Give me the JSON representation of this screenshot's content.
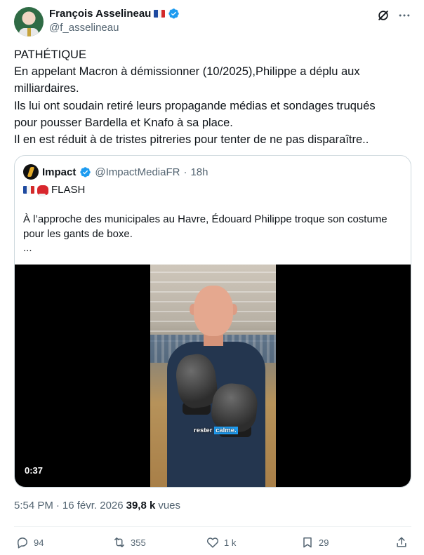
{
  "author": {
    "name": "François Asselineau",
    "handle": "@f_asselineau",
    "flag": "french-flag"
  },
  "post": {
    "lines": [
      "PATHÉTIQUE",
      "En appelant Macron à démissionner (10/2025),Philippe a déplu aux",
      "milliardaires.",
      "Ils lui ont soudain retiré leurs propagande médias et sondages truqués",
      "pour pousser Bardella et Knafo à sa place.",
      "Il en est réduit à de tristes pitreries pour tenter de ne pas disparaître.."
    ]
  },
  "quote": {
    "name": "Impact",
    "handle": "@ImpactMediaFR",
    "separator": "·",
    "time": "18h",
    "flash_label": "FLASH",
    "text_line1": "À l’approche des municipales au Havre, Édouard Philippe troque son costume",
    "text_line2": "pour les gants de boxe.",
    "ellipsis": "...",
    "video": {
      "subtitle_word1": "rester",
      "subtitle_word2": "calme.",
      "duration": "0:37"
    }
  },
  "meta": {
    "time": "5:54 PM",
    "separator": "·",
    "date": "16 févr. 2026",
    "views_count": "39,8 k",
    "views_label": "vues"
  },
  "actions": {
    "replies": "94",
    "reposts": "355",
    "likes": "1 k",
    "bookmarks": "29"
  },
  "colors": {
    "accent": "#1d9bf0",
    "text": "#0f1419",
    "muted": "#536471",
    "border": "#cfd9de"
  }
}
